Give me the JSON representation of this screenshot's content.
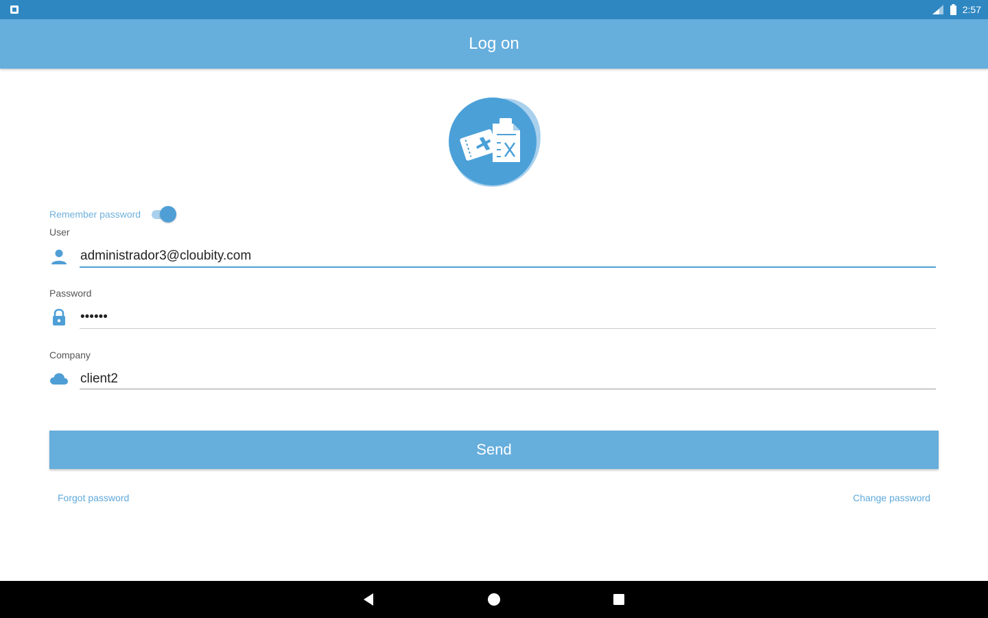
{
  "status_bar": {
    "time": "2:57",
    "left_icon": "notification-icon",
    "right_icons": [
      "signal-icon",
      "battery-icon"
    ]
  },
  "app_bar": {
    "title": "Log on"
  },
  "logo": {
    "icon": "travel-expense-logo-icon"
  },
  "form": {
    "remember": {
      "label": "Remember password",
      "enabled": true
    },
    "user": {
      "label": "User",
      "value": "administrador3@cloubity.com",
      "icon": "person-icon"
    },
    "password": {
      "label": "Password",
      "value": "••••••",
      "icon": "lock-icon"
    },
    "company": {
      "label": "Company",
      "value": "client2",
      "icon": "cloud-icon"
    }
  },
  "actions": {
    "send_label": "Send",
    "forgot_label": "Forgot password",
    "change_label": "Change password"
  },
  "nav_bar": {
    "buttons": [
      "back-icon",
      "home-icon",
      "recents-icon"
    ]
  },
  "colors": {
    "status_bar": "#2f87c2",
    "app_bar": "#66aedc",
    "accent": "#4f9fd6",
    "nav_bar": "#000000"
  }
}
